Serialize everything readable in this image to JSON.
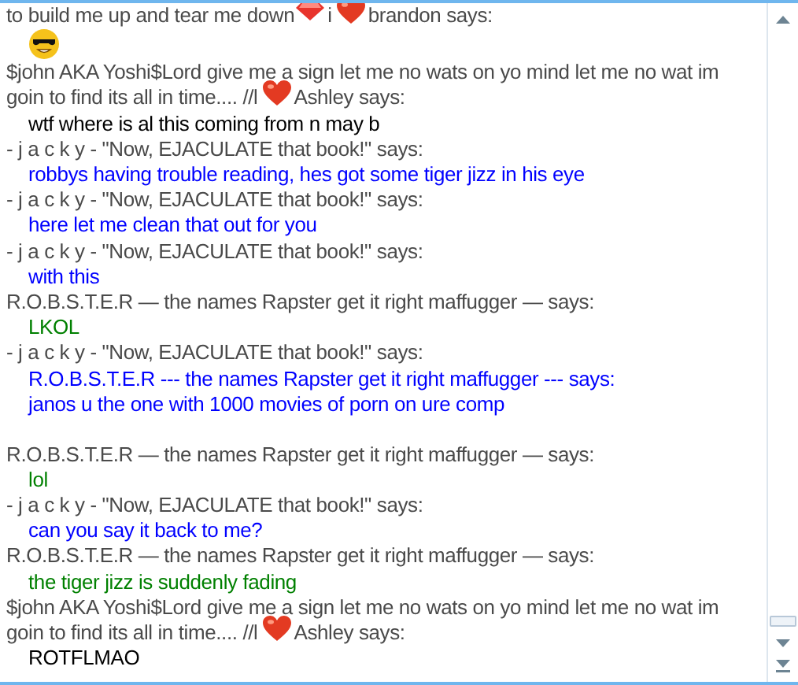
{
  "chat": {
    "entries": [
      {
        "sender": [
          [
            {
              "kind": "text",
              "text": "to build me up and tear me down"
            },
            {
              "kind": "gem"
            },
            {
              "kind": "text",
              "text": "i"
            },
            {
              "kind": "heart"
            },
            {
              "kind": "text",
              "text": "brandon says:"
            }
          ]
        ],
        "message": {
          "lines": [
            [
              {
                "kind": "cool-smiley"
              }
            ]
          ]
        }
      },
      {
        "sender": [
          [
            {
              "kind": "text",
              "text": "$john AKA Yoshi$Lord give me a sign let me no wats on yo mind let me no wat im"
            }
          ],
          [
            {
              "kind": "text",
              "text": "goin to find its all in time.... //l"
            },
            {
              "kind": "heart"
            },
            {
              "kind": "text",
              "text": "Ashley says:"
            }
          ]
        ],
        "message": {
          "color": "#000000",
          "lines": [
            [
              {
                "kind": "text",
                "text": "wtf where is al this coming from n may b"
              }
            ]
          ]
        }
      },
      {
        "sender": [
          [
            {
              "kind": "text",
              "text": "- j a c k y - \"Now, EJACULATE that book!\" says:"
            }
          ]
        ],
        "message": {
          "color": "#0000ff",
          "lines": [
            [
              {
                "kind": "text",
                "text": "robbys having trouble reading, hes got some tiger jizz in his eye"
              }
            ]
          ]
        }
      },
      {
        "sender": [
          [
            {
              "kind": "text",
              "text": "- j a c k y - \"Now, EJACULATE that book!\" says:"
            }
          ]
        ],
        "message": {
          "color": "#0000ff",
          "lines": [
            [
              {
                "kind": "text",
                "text": "here let me clean that out for you"
              }
            ]
          ]
        }
      },
      {
        "sender": [
          [
            {
              "kind": "text",
              "text": "- j a c k y - \"Now, EJACULATE that book!\" says:"
            }
          ]
        ],
        "message": {
          "color": "#0000ff",
          "lines": [
            [
              {
                "kind": "text",
                "text": "with this"
              }
            ]
          ]
        }
      },
      {
        "sender": [
          [
            {
              "kind": "text",
              "text": "R.O.B.S.T.E.R — the names Rapster get it right maffugger — says:"
            }
          ]
        ],
        "message": {
          "color": "#008000",
          "lines": [
            [
              {
                "kind": "text",
                "text": "LKOL"
              }
            ]
          ]
        }
      },
      {
        "sender": [
          [
            {
              "kind": "text",
              "text": "- j a c k y - \"Now, EJACULATE that book!\" says:"
            }
          ]
        ],
        "message": {
          "color": "#0000ff",
          "trailing_blank": true,
          "lines": [
            [
              {
                "kind": "text",
                "text": "R.O.B.S.T.E.R --- the names Rapster get it right maffugger --- says:"
              }
            ],
            [
              {
                "kind": "text",
                "text": "janos u the one with 1000 movies of porn on ure comp"
              }
            ]
          ]
        }
      },
      {
        "sender": [
          [
            {
              "kind": "text",
              "text": "R.O.B.S.T.E.R — the names Rapster get it right maffugger — says:"
            }
          ]
        ],
        "message": {
          "color": "#008000",
          "lines": [
            [
              {
                "kind": "text",
                "text": "lol"
              }
            ]
          ]
        }
      },
      {
        "sender": [
          [
            {
              "kind": "text",
              "text": "- j a c k y - \"Now, EJACULATE that book!\" says:"
            }
          ]
        ],
        "message": {
          "color": "#0000ff",
          "lines": [
            [
              {
                "kind": "text",
                "text": "can you say it back to me?"
              }
            ]
          ]
        }
      },
      {
        "sender": [
          [
            {
              "kind": "text",
              "text": "R.O.B.S.T.E.R — the names Rapster get it right maffugger — says:"
            }
          ]
        ],
        "message": {
          "color": "#008000",
          "lines": [
            [
              {
                "kind": "text",
                "text": "the tiger jizz is suddenly fading"
              }
            ]
          ]
        }
      },
      {
        "sender": [
          [
            {
              "kind": "text",
              "text": "$john AKA Yoshi$Lord give me a sign let me no wats on yo mind let me no wat im"
            }
          ],
          [
            {
              "kind": "text",
              "text": "goin to find its all in time.... //l"
            },
            {
              "kind": "heart"
            },
            {
              "kind": "text",
              "text": "Ashley says:"
            }
          ]
        ],
        "message": {
          "color": "#000000",
          "lines": [
            [
              {
                "kind": "text",
                "text": "ROTFLMAO"
              }
            ]
          ]
        }
      }
    ]
  }
}
